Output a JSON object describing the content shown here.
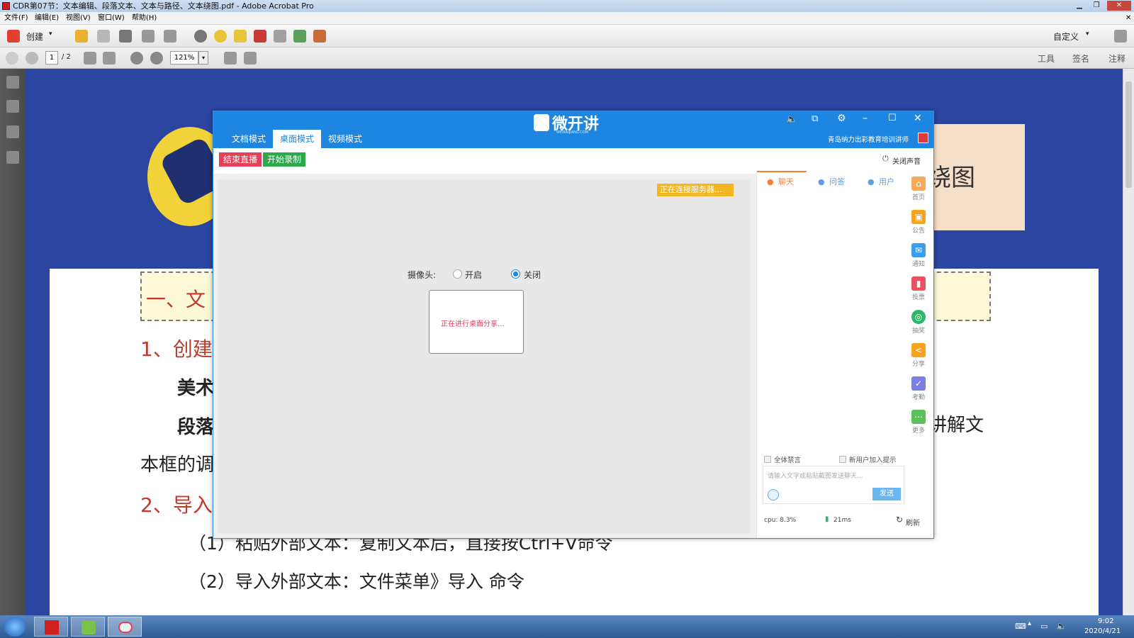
{
  "window": {
    "title": "CDR第07节：文本编辑、段落文本、文本与路径、文本绕图.pdf - Adobe Acrobat Pro"
  },
  "menu": [
    "文件(F)",
    "编辑(E)",
    "视图(V)",
    "窗口(W)",
    "帮助(H)"
  ],
  "toolbar": {
    "create_label": "创建",
    "customize_label": "自定义"
  },
  "nav": {
    "page_current": "1",
    "page_total": "/ 2",
    "zoom": "121%",
    "tools_label": "工具",
    "sign_label": "签名",
    "comment_label": "注释"
  },
  "document": {
    "heading_fragment": "一、文",
    "line1": "1、创建",
    "line2": "美术",
    "line3": "段落",
    "line4": "本框的调",
    "line5": "2、导入",
    "line6": "（1）粘贴外部文本：复制文本后，直接按Ctrl+V命令",
    "line7": "（2）导入外部文本：文件菜单》导入 命令",
    "right_fragment": "讲解文",
    "top_right_fragment": "绕图"
  },
  "app": {
    "logo_text": "微开讲",
    "logo_sub": "WEIKAIJIANG.COM",
    "tabs": [
      "文档模式",
      "桌面模式",
      "视频模式"
    ],
    "org_name": "青岛纳力出彩教育培训讲师",
    "end_live": "结束直播",
    "start_record": "开始录制",
    "mute_label": "关闭声音",
    "connecting": "正在连接服务器...",
    "camera_label": "摄像头:",
    "camera_on": "开启",
    "camera_off": "关闭",
    "sharing_text": "正在进行桌面分享...",
    "right_tabs": [
      "聊天",
      "问答",
      "用户"
    ],
    "side_items": [
      "首页",
      "公告",
      "通知",
      "投票",
      "抽奖",
      "分享",
      "考勤",
      "更多"
    ],
    "mute_all": "全体禁言",
    "join_notice": "新用户加入提示",
    "input_placeholder": "请输入文字或粘贴截图发送聊天...",
    "send_label": "发送",
    "cpu": "cpu: 8.3%",
    "latency": "21ms",
    "refresh_label": "刷新"
  },
  "taskbar": {
    "time": "9:02",
    "date": "2020/4/21"
  }
}
